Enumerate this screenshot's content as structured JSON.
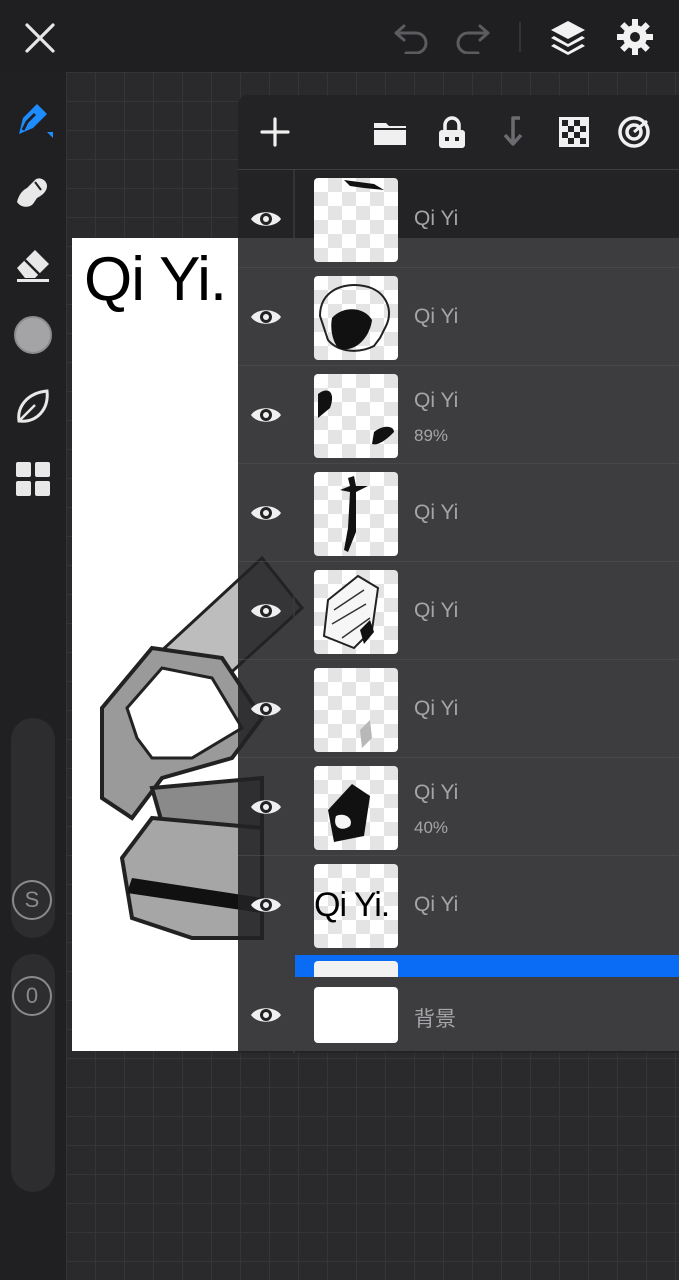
{
  "toolbar_top": {
    "close_icon": "close-icon",
    "undo_icon": "undo-icon",
    "redo_icon": "redo-icon",
    "layers_icon": "layers-icon",
    "settings_icon": "gear-icon"
  },
  "tools": [
    "brush-icon",
    "smudge-icon",
    "eraser-icon",
    "color-icon",
    "leaf-icon",
    "grid-icon"
  ],
  "sliders": {
    "size_label": "S",
    "opacity_label": "0"
  },
  "canvas": {
    "title_text": "Qi Yi."
  },
  "layers_panel": {
    "header_icons": [
      "add-icon",
      "folder-icon",
      "lock-icon",
      "merge-down-icon",
      "alpha-lock-icon",
      "target-icon"
    ],
    "layers": [
      {
        "name": "Qi Yi",
        "opacity": ""
      },
      {
        "name": "Qi Yi",
        "opacity": ""
      },
      {
        "name": "Qi Yi",
        "opacity": "89%"
      },
      {
        "name": "Qi Yi",
        "opacity": ""
      },
      {
        "name": "Qi Yi",
        "opacity": ""
      },
      {
        "name": "Qi Yi",
        "opacity": ""
      },
      {
        "name": "Qi Yi",
        "opacity": "40%"
      },
      {
        "name": "Qi Yi",
        "opacity": "",
        "thumb_text": "Qi Yi."
      }
    ],
    "background_layer": {
      "name": "背景"
    }
  },
  "colors": {
    "accent": "#0a6cf5",
    "panel": "#222224",
    "toolbar": "#1f1f21",
    "text": "#a5a5a9"
  }
}
